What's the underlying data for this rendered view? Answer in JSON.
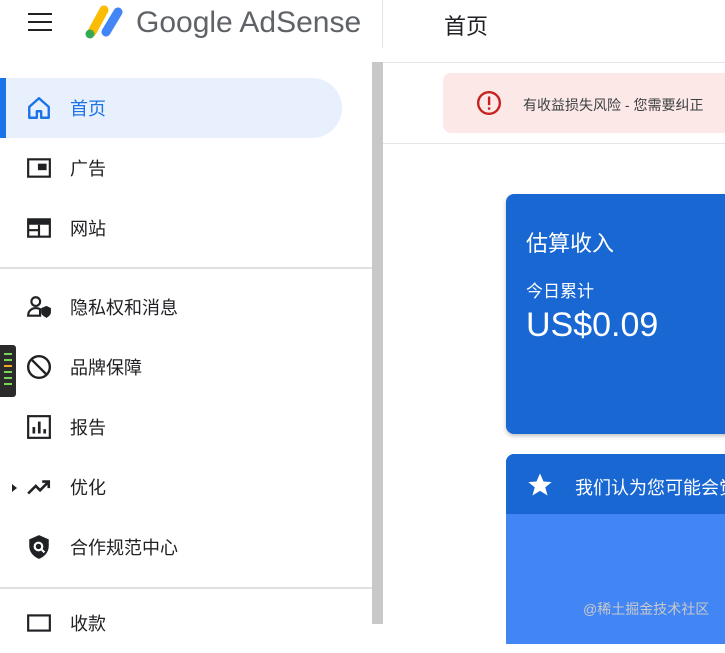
{
  "header": {
    "brand": "Google AdSense",
    "page_title": "首页"
  },
  "sidebar": {
    "items": [
      {
        "label": "首页",
        "icon": "home-icon"
      },
      {
        "label": "广告",
        "icon": "ads-icon"
      },
      {
        "label": "网站",
        "icon": "sites-icon"
      },
      {
        "label": "隐私权和消息",
        "icon": "privacy-icon"
      },
      {
        "label": "品牌保障",
        "icon": "block-icon"
      },
      {
        "label": "报告",
        "icon": "report-icon"
      },
      {
        "label": "优化",
        "icon": "trending-up-icon"
      },
      {
        "label": "合作规范中心",
        "icon": "policy-shield-icon"
      },
      {
        "label": "收款",
        "icon": "payments-icon"
      }
    ]
  },
  "alert": {
    "text": "有收益损失风险 - 您需要纠正"
  },
  "earnings": {
    "title": "估算收入",
    "period": "今日累计",
    "value": "US$0.09"
  },
  "recommendation": {
    "text": "我们认为您可能会觉"
  },
  "watermark": "@稀土掘金技术社区",
  "colors": {
    "accent": "#1a73e8",
    "card": "#1967d2",
    "alert_bg": "#fce8e6",
    "alert_icon": "#c5221f"
  }
}
